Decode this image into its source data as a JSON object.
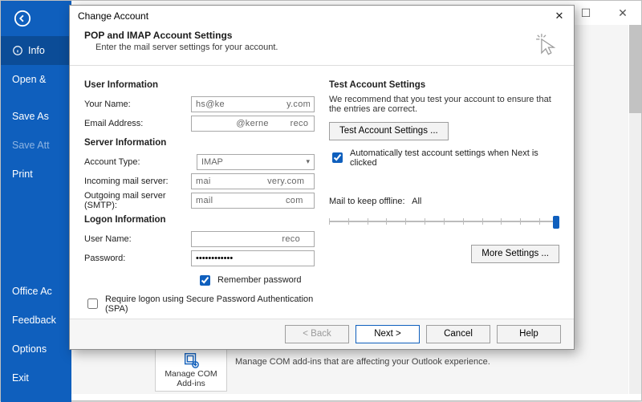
{
  "bgwin": {
    "sidebar": {
      "items": [
        "Info",
        "Open &",
        "Save As",
        "Save Att",
        "Print"
      ],
      "bottom": [
        "Office Ac",
        "Feedback",
        "Options",
        "Exit"
      ],
      "selected_index": 0
    },
    "com": {
      "btn_line1": "Manage COM",
      "btn_line2": "Add-ins",
      "desc": "Manage COM add-ins that are affecting your Outlook experience."
    }
  },
  "dialog": {
    "title": "Change Account",
    "heading": "POP and IMAP Account Settings",
    "subheading": "Enter the mail server settings for your account.",
    "left": {
      "sec_user": "User Information",
      "your_name_label": "Your Name:",
      "your_name_value": "hs@ke                       y.com",
      "email_label": "Email Address:",
      "email_value": "               @kerne        reco",
      "sec_server": "Server Information",
      "acct_type_label": "Account Type:",
      "acct_type_value": "IMAP",
      "incoming_label": "Incoming mail server:",
      "incoming_value": "mai                     very.com",
      "outgoing_label": "Outgoing mail server (SMTP):",
      "outgoing_value": "mail                           com",
      "sec_logon": "Logon Information",
      "username_label": "User Name:",
      "username_value": "                                reco",
      "password_label": "Password:",
      "password_value": "************",
      "remember": "Remember password",
      "spa": "Require logon using Secure Password Authentication (SPA)"
    },
    "right": {
      "sec_test": "Test Account Settings",
      "desc": "We recommend that you test your account to ensure that the entries are correct.",
      "test_btn": "Test Account Settings ...",
      "auto_test": "Automatically test account settings when Next is clicked",
      "mail_keep_label": "Mail to keep offline:",
      "mail_keep_value": "All",
      "more_btn": "More Settings ..."
    },
    "buttons": {
      "back": "< Back",
      "next": "Next >",
      "cancel": "Cancel",
      "help": "Help"
    }
  }
}
